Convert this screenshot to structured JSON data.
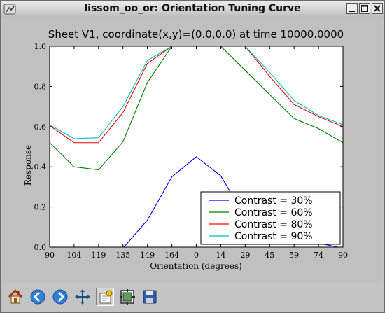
{
  "window": {
    "title": "lissom_oo_or: Orientation Tuning Curve"
  },
  "chart_data": {
    "type": "line",
    "title": "Sheet V1, coordinate(x,y)=(0.0,0.0) at time 10000.0000",
    "xlabel": "Orientation (degrees)",
    "ylabel": "Response",
    "x_tick_labels": [
      "90",
      "104",
      "119",
      "135",
      "149",
      "164",
      "0",
      "14",
      "29",
      "45",
      "59",
      "74",
      "90"
    ],
    "y_tick_labels": [
      "0.0",
      "0.2",
      "0.4",
      "0.6",
      "0.8",
      "1.0"
    ],
    "ylim": [
      0,
      1
    ],
    "grid": false,
    "legend_position": "lower-right",
    "series": [
      {
        "name": "Contrast = 30%",
        "color": "#0000ff",
        "values": [
          -0.05,
          -0.05,
          -0.05,
          -0.005,
          0.135,
          0.35,
          0.45,
          0.355,
          0.15,
          0.04,
          0.02,
          0.02,
          -0.005
        ]
      },
      {
        "name": "Contrast = 60%",
        "color": "#008000",
        "values": [
          0.52,
          0.4,
          0.385,
          0.525,
          0.82,
          1.0,
          1.0,
          1.0,
          0.88,
          0.76,
          0.64,
          0.59,
          0.52
        ]
      },
      {
        "name": "Contrast = 80%",
        "color": "#ff0000",
        "values": [
          0.605,
          0.52,
          0.52,
          0.67,
          0.915,
          1.0,
          1.0,
          1.0,
          1.0,
          0.85,
          0.71,
          0.65,
          0.6
        ]
      },
      {
        "name": "Contrast = 90%",
        "color": "#00bfbf",
        "values": [
          0.61,
          0.54,
          0.545,
          0.7,
          0.93,
          1.0,
          1.0,
          1.0,
          1.0,
          0.87,
          0.73,
          0.655,
          0.61
        ]
      }
    ]
  },
  "toolbar": {
    "buttons": [
      {
        "icon": "home-icon"
      },
      {
        "icon": "back-arrow-icon"
      },
      {
        "icon": "forward-arrow-icon"
      },
      {
        "icon": "pan-icon"
      },
      {
        "icon": "zoom-rect-icon"
      },
      {
        "icon": "subplots-icon"
      },
      {
        "icon": "save-icon"
      }
    ]
  }
}
